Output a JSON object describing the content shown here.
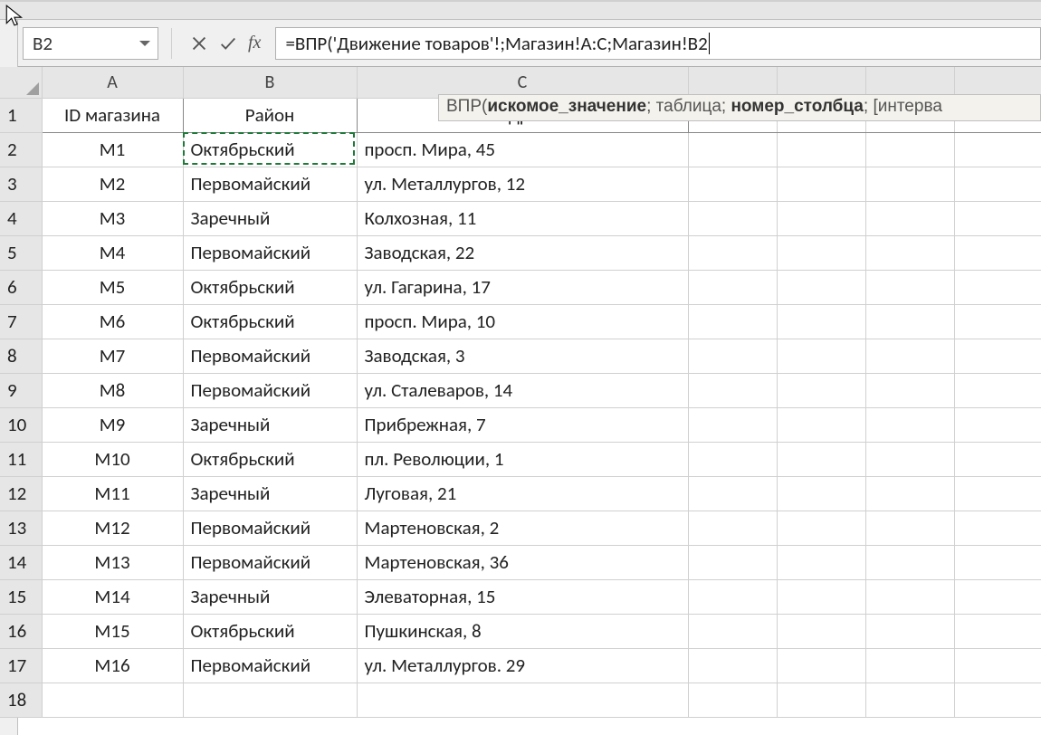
{
  "nameBox": "B2",
  "formula": "=ВПР('Движение товаров'!;Магазин!A:C;Магазин!B2",
  "fxLabel": "fx",
  "tooltip": {
    "fn": "ВПР",
    "arg1_label": "искомое_значение",
    "arg2_label": "таблица",
    "arg3_label_bold": "номер_столбца",
    "arg4_label": "[интерва"
  },
  "columnLetters": [
    "A",
    "B",
    "C",
    "",
    "",
    "",
    ""
  ],
  "headers": {
    "A": "ID магазина",
    "B": "Район",
    "C": "Адрес"
  },
  "rows": [
    {
      "n": 1,
      "id": "",
      "district": "",
      "address": ""
    },
    {
      "n": 2,
      "id": "M1",
      "district": "Октябрьский",
      "address": "просп. Мира, 45"
    },
    {
      "n": 3,
      "id": "M2",
      "district": "Первомайский",
      "address": "ул. Металлургов, 12"
    },
    {
      "n": 4,
      "id": "M3",
      "district": "Заречный",
      "address": "Колхозная, 11"
    },
    {
      "n": 5,
      "id": "M4",
      "district": "Первомайский",
      "address": "Заводская, 22"
    },
    {
      "n": 6,
      "id": "M5",
      "district": "Октябрьский",
      "address": "ул. Гагарина, 17"
    },
    {
      "n": 7,
      "id": "M6",
      "district": "Октябрьский",
      "address": "просп. Мира, 10"
    },
    {
      "n": 8,
      "id": "M7",
      "district": "Первомайский",
      "address": "Заводская, 3"
    },
    {
      "n": 9,
      "id": "M8",
      "district": "Первомайский",
      "address": "ул. Сталеваров, 14"
    },
    {
      "n": 10,
      "id": "M9",
      "district": "Заречный",
      "address": "Прибрежная, 7"
    },
    {
      "n": 11,
      "id": "M10",
      "district": "Октябрьский",
      "address": "пл. Революции, 1"
    },
    {
      "n": 12,
      "id": "M11",
      "district": "Заречный",
      "address": "Луговая, 21"
    },
    {
      "n": 13,
      "id": "M12",
      "district": "Первомайский",
      "address": "Мартеновская, 2"
    },
    {
      "n": 14,
      "id": "M13",
      "district": "Первомайский",
      "address": "Мартеновская, 36"
    },
    {
      "n": 15,
      "id": "M14",
      "district": "Заречный",
      "address": "Элеваторная, 15"
    },
    {
      "n": 16,
      "id": "M15",
      "district": "Октябрьский",
      "address": "Пушкинская, 8"
    },
    {
      "n": 17,
      "id": "M16",
      "district": "Первомайский",
      "address": "ул. Металлургов. 29"
    },
    {
      "n": 18,
      "id": "",
      "district": "",
      "address": ""
    }
  ],
  "activeCell": {
    "row": 2,
    "col": "B"
  }
}
